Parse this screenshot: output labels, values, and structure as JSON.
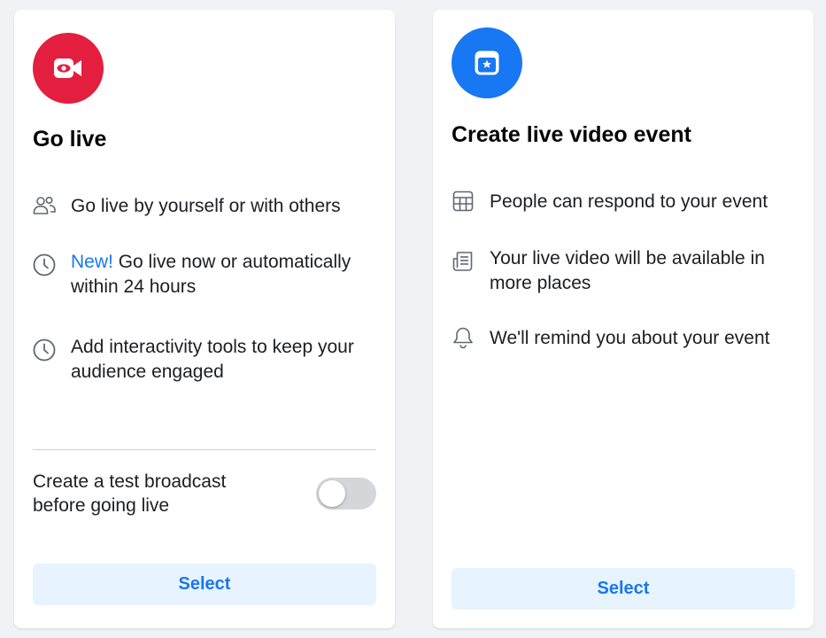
{
  "colors": {
    "live_accent": "#e41e3f",
    "event_accent": "#1877f2",
    "link_blue": "#1877f2",
    "button_bg": "#e7f3ff"
  },
  "go_live": {
    "icon": "video-camera-icon",
    "title": "Go live",
    "features": [
      {
        "icon": "people-icon",
        "text": "Go live by yourself or with others"
      },
      {
        "icon": "clock-icon",
        "highlight": "New!",
        "text": " Go live now or automatically within 24 hours"
      },
      {
        "icon": "clock-icon",
        "text": "Add interactivity tools to keep your audience engaged"
      }
    ],
    "test_broadcast_label": "Create a test broadcast before going live",
    "test_broadcast_enabled": false,
    "select_label": "Select"
  },
  "live_event": {
    "icon": "calendar-star-icon",
    "title": "Create live video event",
    "features": [
      {
        "icon": "table-grid-icon",
        "text": "People can respond to your event"
      },
      {
        "icon": "news-feed-icon",
        "text": "Your live video will be available in more places"
      },
      {
        "icon": "bell-icon",
        "text": "We'll remind you about your event"
      }
    ],
    "select_label": "Select"
  }
}
